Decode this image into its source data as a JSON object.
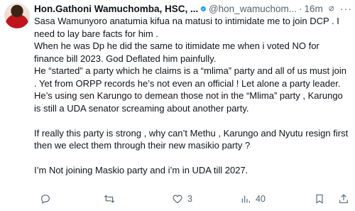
{
  "tweet": {
    "display_name": "Hon.Gathoni Wamuchomba, HSC, ...",
    "handle": "@hon_wamuchom...",
    "separator": "·",
    "time": "16m",
    "more": "···",
    "paragraphs": [
      "Sasa Wamunyoro anatumia kifua na matusi to intimidate me to join DCP . I need to lay bare facts for him .",
      "When he was Dp he did the same to itimidate me when i voted NO for finance bill 2023. God Deflated him painfully.",
      "He “started” a party which he claims is a “mlima” party and all of us must join . Yet from ORPP records he’s not even an official ! Let alone a party leader.",
      "He’s using sen Karungo to demean those not in the “Mlima” party , Karungo is still a UDA senator screaming about another party.",
      "",
      "If really this party is strong , why can’t Methu , Karungo and Nyutu resign first then we elect them through their new masikio party ?",
      "",
      "I’m Not joining Maskio party and i’m in UDA till 2027."
    ]
  },
  "actions": {
    "reply_count": "",
    "repost_count": "",
    "like_count": "3",
    "views_count": "40"
  },
  "colors": {
    "verified_badge": "#1d9bf0",
    "muted_text": "#536471",
    "body_text": "#0f1419"
  },
  "icons": [
    "verified-badge-icon",
    "grok-icon",
    "more-icon",
    "reply-icon",
    "repost-icon",
    "like-icon",
    "views-icon",
    "bookmark-icon",
    "share-icon"
  ]
}
